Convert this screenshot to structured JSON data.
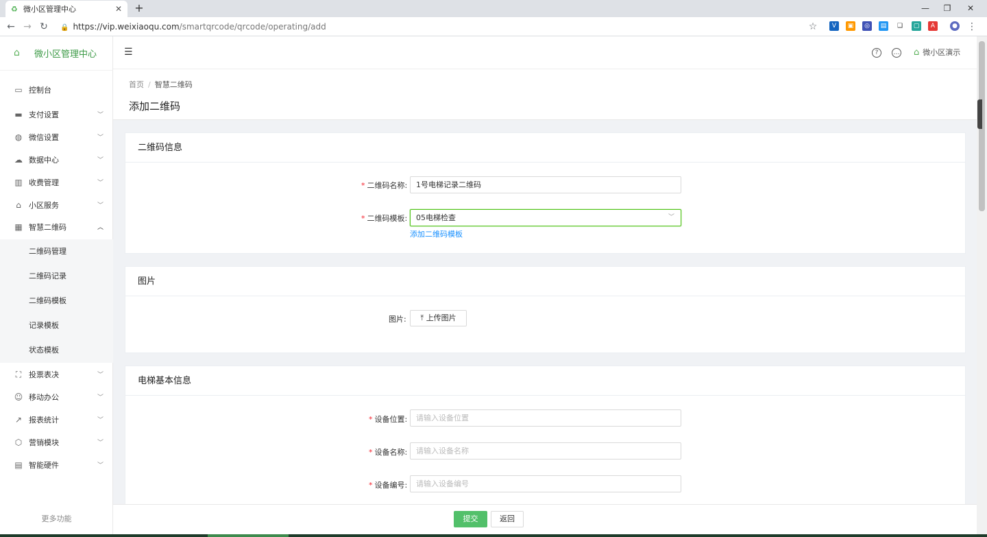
{
  "browser": {
    "tab_title": "微小区管理中心",
    "tab_close": "✕",
    "new_tab": "+",
    "url_host": "https://vip.weixiaoqu.com",
    "url_path": "/smartqrcode/qrcode/operating/add"
  },
  "sidebar": {
    "logo_text": "微小区管理中心",
    "items": [
      {
        "label": "控制台",
        "icon": "dashboard-icon"
      },
      {
        "label": "支付设置",
        "icon": "payment-icon"
      },
      {
        "label": "微信设置",
        "icon": "wechat-icon"
      },
      {
        "label": "数据中心",
        "icon": "cloud-icon"
      },
      {
        "label": "收费管理",
        "icon": "fee-icon"
      },
      {
        "label": "小区服务",
        "icon": "home-icon"
      },
      {
        "label": "智慧二维码",
        "icon": "qrcode-icon"
      },
      {
        "label": "投票表决",
        "icon": "vote-icon"
      },
      {
        "label": "移动办公",
        "icon": "user-icon"
      },
      {
        "label": "报表统计",
        "icon": "chart-icon"
      },
      {
        "label": "营销模块",
        "icon": "cube-icon"
      },
      {
        "label": "智能硬件",
        "icon": "calculator-icon"
      }
    ],
    "submenu": [
      "二维码管理",
      "二维码记录",
      "二维码模板",
      "记录模板",
      "状态模板"
    ],
    "more": "更多功能"
  },
  "header": {
    "user_name": "微小区演示"
  },
  "page": {
    "breadcrumb_home": "首页",
    "breadcrumb_sep": "/",
    "breadcrumb_current": "智慧二维码",
    "title": "添加二维码"
  },
  "sections": {
    "qrcode_info": {
      "title": "二维码信息",
      "name_label": "二维码名称:",
      "name_value": "1号电梯记录二维码",
      "template_label": "二维码模板:",
      "template_value": "05电梯检查",
      "add_template_link": "添加二维码模板"
    },
    "image": {
      "title": "图片",
      "label": "图片:",
      "upload_button": "上传图片"
    },
    "elevator": {
      "title": "电梯基本信息",
      "location_label": "设备位置:",
      "location_placeholder": "请输入设备位置",
      "name_label": "设备名称:",
      "name_placeholder": "请输入设备名称",
      "code_label": "设备编号:",
      "code_placeholder": "请输入设备编号"
    }
  },
  "footer": {
    "submit": "提交",
    "back": "返回"
  },
  "colors": {
    "brand_green": "#52c06a",
    "link_blue": "#1890ff",
    "required_red": "#f5222d"
  }
}
